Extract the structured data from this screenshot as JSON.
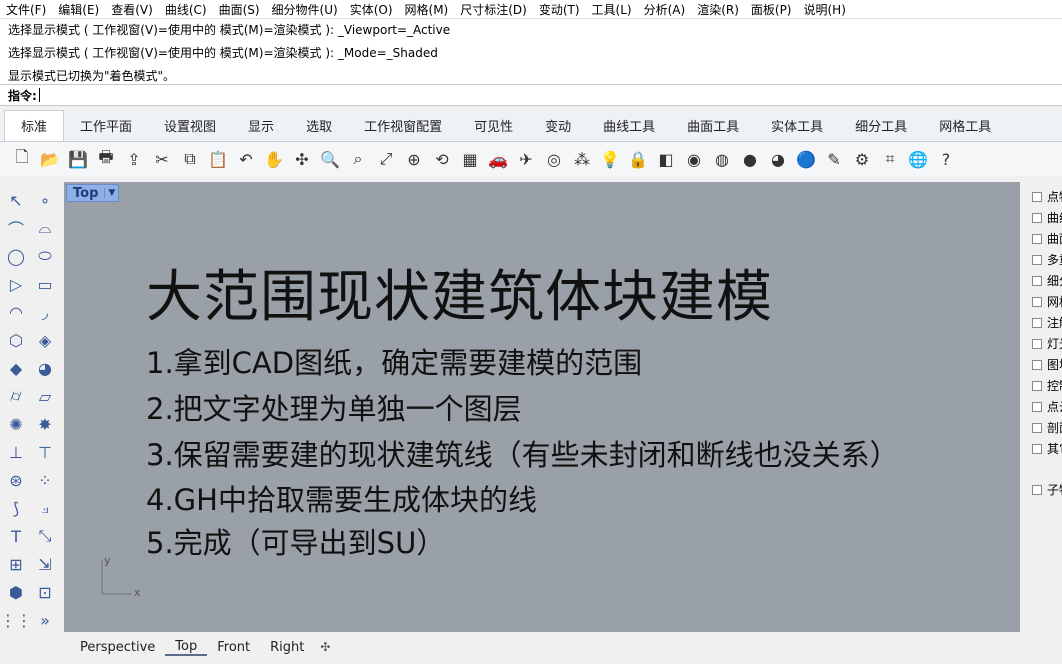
{
  "menu": [
    "文件(F)",
    "编辑(E)",
    "查看(V)",
    "曲线(C)",
    "曲面(S)",
    "细分物件(U)",
    "实体(O)",
    "网格(M)",
    "尺寸标注(D)",
    "变动(T)",
    "工具(L)",
    "分析(A)",
    "渲染(R)",
    "面板(P)",
    "说明(H)"
  ],
  "command_history": [
    "选择显示模式 ( 工作视窗(V)=使用中的  模式(M)=渲染模式 ): _Viewport=_Active",
    "选择显示模式 ( 工作视窗(V)=使用中的  模式(M)=渲染模式 ): _Mode=_Shaded",
    "显示模式已切换为\"着色模式\"。"
  ],
  "command_prompt": {
    "label": "指令:",
    "value": ""
  },
  "toolbar_tabs": [
    "标准",
    "工作平面",
    "设置视图",
    "显示",
    "选取",
    "工作视窗配置",
    "可见性",
    "变动",
    "曲线工具",
    "曲面工具",
    "实体工具",
    "细分工具",
    "网格工具"
  ],
  "active_tab_index": 0,
  "toolbar_icons": [
    "new-file-icon",
    "open-folder-icon",
    "save-icon",
    "print-icon",
    "import-icon",
    "cut-icon",
    "copy-icon",
    "paste-icon",
    "undo-icon",
    "pan-hand-icon",
    "rotate-view-icon",
    "zoom-icon",
    "zoom-window-icon",
    "zoom-extents-icon",
    "zoom-selected-icon",
    "rotate-icon",
    "four-viewports-icon",
    "car-icon",
    "plane-icon",
    "circle-target-icon",
    "points-icon",
    "lightbulb-icon",
    "lock-icon",
    "layers-icon",
    "color-wheel-icon",
    "sphere-wire-icon",
    "sphere-shaded-icon",
    "sphere-render-icon",
    "render-blue-icon",
    "pen-icon",
    "settings-gear-icon",
    "dimension-icon",
    "globe-icon",
    "help-icon"
  ],
  "left_tools": [
    "select-arrow-icon",
    "point-icon",
    "polyline-icon",
    "curve-icon",
    "circle-icon",
    "ellipse-icon",
    "polygon-icon",
    "rectangle-icon",
    "arc-icon",
    "fillet-curve-icon",
    "surface-icon",
    "loft-icon",
    "box-solid-icon",
    "sphere-solid-icon",
    "cylinder-icon",
    "plane-surface-icon",
    "gear-tool-icon",
    "explode-icon",
    "extend-icon",
    "split-icon",
    "boolean-icon",
    "points-cloud-icon",
    "offset-icon",
    "trim-icon",
    "text-icon",
    "scale-icon",
    "array-icon",
    "drag-icon",
    "cube-icon",
    "measure-icon",
    "grid-dots-icon",
    "more-icon"
  ],
  "viewport": {
    "name": "Top",
    "title": "大范围现状建筑体块建模",
    "steps": [
      "1.拿到CAD图纸，确定需要建模的范围",
      "2.把文字处理为单独一个图层",
      "3.保留需要建的现状建筑线（有些未封闭和断线也没关系）",
      "4.GH中拾取需要生成体块的线",
      "5.完成（可导出到SU）"
    ],
    "axis_x": "x",
    "axis_y": "y"
  },
  "right_panel_items": [
    "点物件",
    "曲线",
    "曲面",
    "多重曲面",
    "细分物件",
    "网格",
    "注解",
    "灯光",
    "图块",
    "控制点",
    "点云",
    "剖面",
    "其它",
    "子物件"
  ],
  "view_tabs": [
    "Perspective",
    "Top",
    "Front",
    "Right"
  ],
  "active_view_tab": 1,
  "view_tab_add": "✣"
}
